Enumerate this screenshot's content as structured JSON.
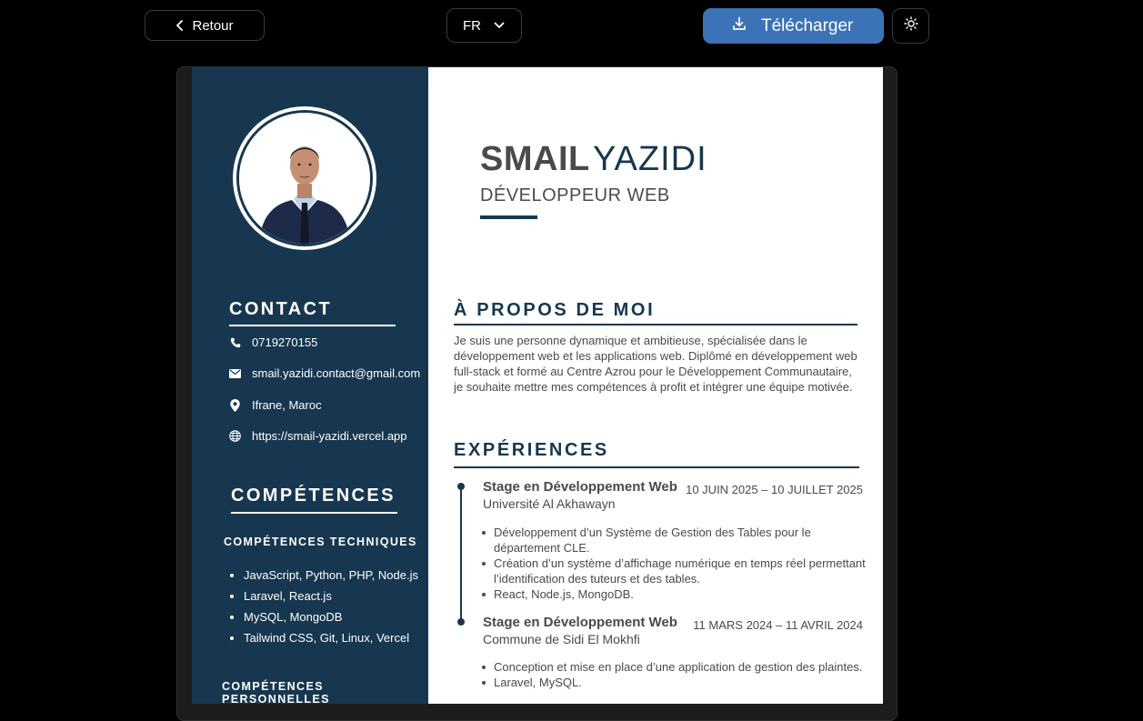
{
  "toolbar": {
    "back_label": "Retour",
    "language_value": "FR",
    "download_label": "Télécharger",
    "theme_icon": "sun-icon",
    "accent": "#3b73b6"
  },
  "cv": {
    "sidebar_color": "#173750",
    "name_first": "SMAIL",
    "name_last": "YAZIDI",
    "job_title": "DÉVELOPPEUR WEB",
    "contact": {
      "heading": "CONTACT",
      "phone": "0719270155",
      "email": "smail.yazidi.contact@gmail.com",
      "location": "Ifrane, Maroc",
      "website": "https://smail-yazidi.vercel.app"
    },
    "skills": {
      "heading": "COMPÉTENCES",
      "technical_heading": "COMPÉTENCES TECHNIQUES",
      "technical": [
        "JavaScript, Python, PHP, Node.js",
        "Laravel, React.js",
        "MySQL, MongoDB",
        "Tailwind CSS, Git, Linux, Vercel"
      ],
      "personal_heading": "COMPÉTENCES PERSONNELLES"
    },
    "about": {
      "heading": "À PROPOS DE MOI",
      "text": "Je suis une personne dynamique et ambitieuse, spécialisée dans le développement web et les applications web. Diplômé en développement web full-stack et formé au Centre Azrou pour le Développement Communautaire, je souhaite mettre mes compétences à profit et intégrer une équipe motivée."
    },
    "experience": {
      "heading": "EXPÉRIENCES",
      "jobs": [
        {
          "role": "Stage en Développement Web",
          "org": "Université Al Akhawayn",
          "dates": "10 JUIN 2025 – 10 JUILLET 2025",
          "bullets": [
            "Développement d’un Système de Gestion des Tables pour le département CLE.",
            "Création d’un système d’affichage numérique en temps réel permettant l’identification des tuteurs et des tables.",
            "React, Node.js, MongoDB."
          ]
        },
        {
          "role": "Stage en Développement Web",
          "org": "Commune de Sidi El Mokhfi",
          "dates": "11 MARS 2024 – 11 AVRIL 2024",
          "bullets": [
            "Conception et mise en place d’une application de gestion des plaintes.",
            "Laravel, MySQL."
          ]
        }
      ]
    }
  }
}
